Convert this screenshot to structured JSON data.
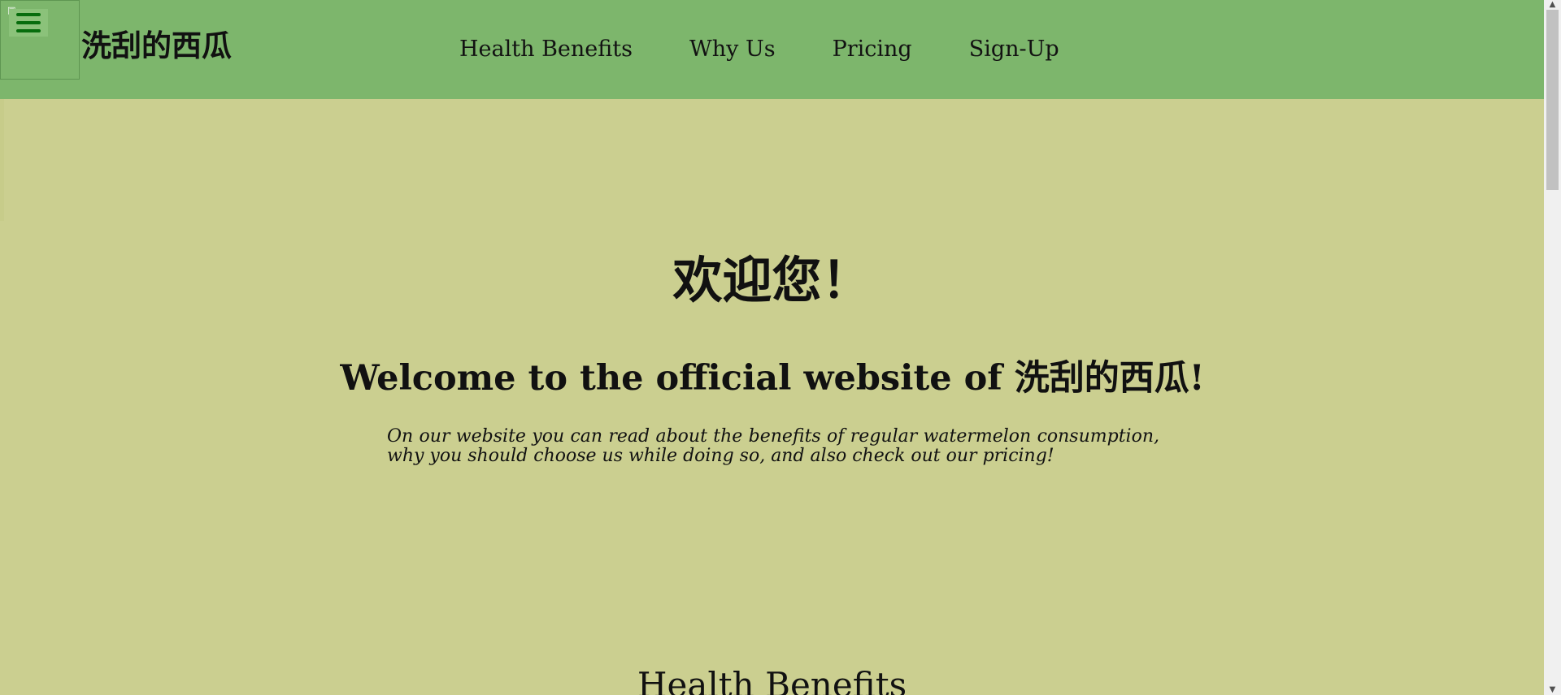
{
  "header": {
    "brand": "洗刮的西瓜",
    "menu_icon": "hamburger-menu-icon",
    "broken_image_icon": "broken-image-icon",
    "nav": [
      {
        "label": "Health Benefits"
      },
      {
        "label": "Why Us"
      },
      {
        "label": "Pricing"
      },
      {
        "label": "Sign-Up"
      }
    ],
    "header_color": "#7db66c",
    "menu_color": "#076d0d"
  },
  "hero": {
    "title": "欢迎您！",
    "subtitle": "Welcome to the official website of 洗刮的西瓜!",
    "description": "On our website you can read about the benefits of regular watermelon consumption, why you should choose us while doing so, and also check out our pricing!"
  },
  "sections": {
    "health_benefits": {
      "heading": "Health Benefits"
    }
  },
  "page": {
    "background_color": "#cbcf90"
  },
  "scrollbar": {
    "up_icon": "scroll-up-arrow-icon",
    "down_icon": "scroll-down-arrow-icon"
  }
}
